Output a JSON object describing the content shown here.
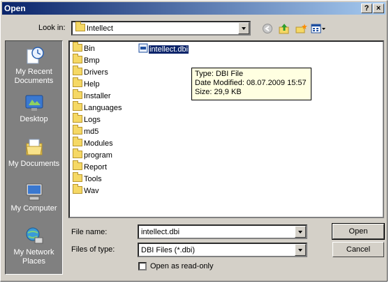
{
  "window": {
    "title": "Open",
    "help_button": "?",
    "close_button": "×"
  },
  "toolbar": {
    "look_in_label": "Look in:",
    "look_in_value": "Intellect"
  },
  "places": [
    {
      "label": "My Recent Documents",
      "icon": "recent-documents-icon"
    },
    {
      "label": "Desktop",
      "icon": "desktop-icon"
    },
    {
      "label": "My Documents",
      "icon": "my-documents-icon"
    },
    {
      "label": "My Computer",
      "icon": "my-computer-icon"
    },
    {
      "label": "My Network Places",
      "icon": "network-places-icon"
    }
  ],
  "folders": [
    "Bin",
    "Bmp",
    "Drivers",
    "Help",
    "Installer",
    "Languages",
    "Logs",
    "md5",
    "Modules",
    "program",
    "Report",
    "Tools",
    "Wav"
  ],
  "selected_file": "intellect.dbi",
  "tooltip": {
    "type": "Type: DBI File",
    "date": "Date Modified: 08.07.2009 15:57",
    "size": "Size: 29,9 KB"
  },
  "footer": {
    "file_name_label": "File name:",
    "file_name_value": "intellect.dbi",
    "file_type_label": "Files of type:",
    "file_type_value": "DBI Files (*.dbi)",
    "read_only_label": "Open as read-only"
  },
  "buttons": {
    "open": "Open",
    "cancel": "Cancel"
  }
}
